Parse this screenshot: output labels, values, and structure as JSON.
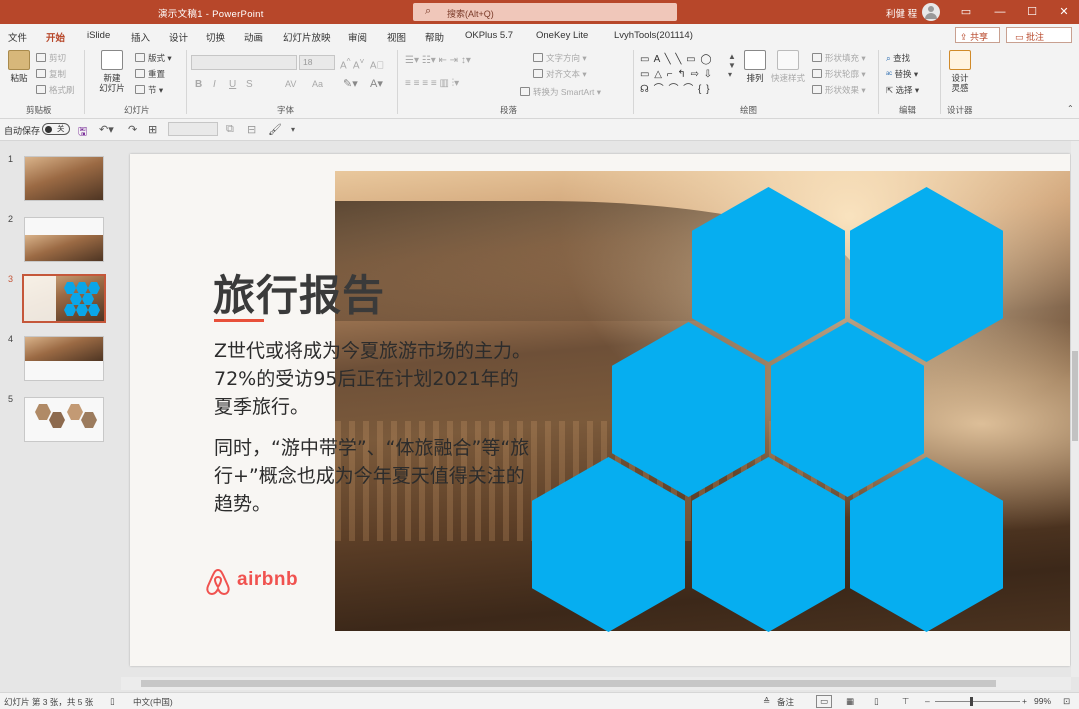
{
  "window": {
    "doc_title": "演示文稿1  -  PowerPoint",
    "search_placeholder": "搜索(Alt+Q)",
    "user_name": "利健 程",
    "controls": {
      "ribbon_opts": "▭",
      "minimize": "—",
      "maximize": "☐",
      "close": "✕"
    }
  },
  "tabs": [
    "文件",
    "开始",
    "iSlide",
    "插入",
    "设计",
    "切换",
    "动画",
    "幻灯片放映",
    "审阅",
    "视图",
    "帮助",
    "OKPlus 5.7",
    "OneKey Lite",
    "LvyhTools(201114)"
  ],
  "active_tab": "开始",
  "ribbon_actions": {
    "share": "共享",
    "comment": "批注"
  },
  "ribbon": {
    "clipboard": {
      "paste": "粘贴",
      "cut": "剪切",
      "copy": "复制",
      "format_painter": "格式刷",
      "label": "剪贴板"
    },
    "slides": {
      "new_slide_line1": "新建",
      "new_slide_line2": "幻灯片",
      "layout": "版式",
      "reset": "重置",
      "section": "节",
      "label": "幻灯片"
    },
    "font": {
      "font_size": "18",
      "label": "字体",
      "bold": "B",
      "italic": "I",
      "underline": "U",
      "strike": "S",
      "spacing": "AV",
      "case": "Aa"
    },
    "paragraph": {
      "text_direction": "文字方向",
      "align_text": "对齐文本",
      "smartart": "转换为 SmartArt",
      "label": "段落"
    },
    "drawing": {
      "arrange": "排列",
      "quick_styles": "快速样式",
      "shape_fill": "形状填充",
      "shape_outline": "形状轮廓",
      "shape_effects": "形状效果",
      "label": "绘图"
    },
    "editing": {
      "find": "查找",
      "replace": "替换",
      "select": "选择",
      "label": "编辑"
    },
    "designer": {
      "design_ideas_line1": "设计",
      "design_ideas_line2": "灵感",
      "label": "设计器"
    }
  },
  "qat": {
    "autosave": "自动保存",
    "autosave_state": "关"
  },
  "thumbnails": [
    {
      "num": "1"
    },
    {
      "num": "2"
    },
    {
      "num": "3",
      "active": true
    },
    {
      "num": "4"
    },
    {
      "num": "5"
    }
  ],
  "slide": {
    "title": "旅行报告",
    "paragraph1": "Z世代或将成为今夏旅游市场的主力。72%的受访95后正在计划2021年的夏季旅行。",
    "paragraph2": "同时，“游中带学”、“体旅融合”等“旅行+”概念也成为今年夏天值得关注的趋势。",
    "logo_text": "airbnb",
    "accent_color": "#e8503a",
    "hex_color": "#06aef0"
  },
  "status": {
    "slide_info": "幻灯片 第 3 张，共 5 张",
    "language": "中文(中国)",
    "notes": "备注",
    "zoom": "99%"
  }
}
